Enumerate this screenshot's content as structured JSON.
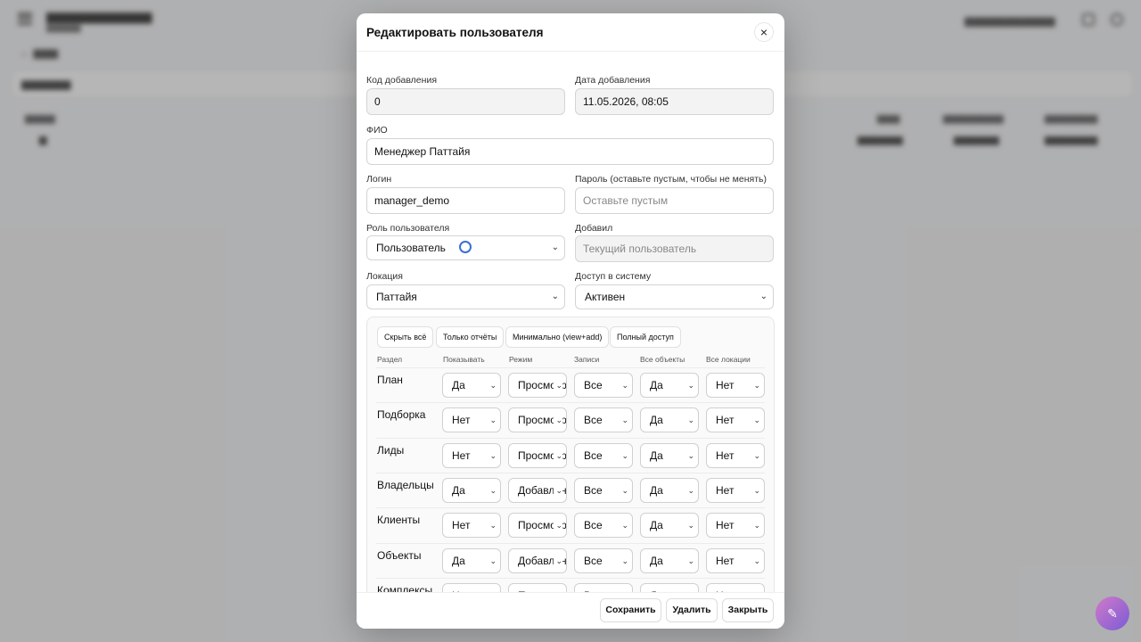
{
  "modal": {
    "title": "Редактировать пользователя",
    "close_label": "×",
    "fields": {
      "code_label": "Код добавления",
      "code_value": "0",
      "date_label": "Дата добавления",
      "date_value": "11.05.2026, 08:05",
      "fio_label": "ФИО",
      "fio_value": "Менеджер Паттайя",
      "login_label": "Логин",
      "login_value": "manager_demo",
      "password_label": "Пароль",
      "password_hint": "(оставьте пустым, чтобы не менять)",
      "password_placeholder": "Оставьте пустым",
      "role_label": "Роль пользователя",
      "role_value": "Пользователь",
      "added_by_label": "Добавил",
      "added_by_placeholder": "Текущий пользователь",
      "location_label": "Локация",
      "location_value": "Паттайя",
      "access_label": "Доступ в систему",
      "access_value": "Активен"
    },
    "presets": [
      "Скрыть всё",
      "Только отчёты",
      "Минимально (view+add)",
      "Полный доступ"
    ],
    "perm_headers": [
      "Раздел",
      "Показывать",
      "Режим",
      "Записи",
      "Все объекты",
      "Все локации"
    ],
    "perm_rows": [
      {
        "name": "План",
        "show": "Да",
        "mode": "Просмотр",
        "records": "Все",
        "all_objects": "Да",
        "all_locations": "Нет"
      },
      {
        "name": "Подборка",
        "show": "Нет",
        "mode": "Просмотр",
        "records": "Все",
        "all_objects": "Да",
        "all_locations": "Нет"
      },
      {
        "name": "Лиды",
        "show": "Нет",
        "mode": "Просмотр",
        "records": "Все",
        "all_objects": "Да",
        "all_locations": "Нет"
      },
      {
        "name": "Владельцы",
        "show": "Да",
        "mode": "Добавление",
        "records": "Все",
        "all_objects": "Да",
        "all_locations": "Нет"
      },
      {
        "name": "Клиенты",
        "show": "Нет",
        "mode": "Просмотр",
        "records": "Все",
        "all_objects": "Да",
        "all_locations": "Нет"
      },
      {
        "name": "Объекты",
        "show": "Да",
        "mode": "Добавление",
        "records": "Все",
        "all_objects": "Да",
        "all_locations": "Нет"
      },
      {
        "name": "Комплексы",
        "show": "Нет",
        "mode": "Просмотр",
        "records": "Все",
        "all_objects": "Да",
        "all_locations": "Нет"
      }
    ],
    "footer": {
      "save": "Сохранить",
      "delete": "Удалить",
      "close": "Закрыть"
    }
  },
  "colors": {
    "overlay": "#505050",
    "accent": "#3b6fd4",
    "fab": "#9b6bd0"
  }
}
